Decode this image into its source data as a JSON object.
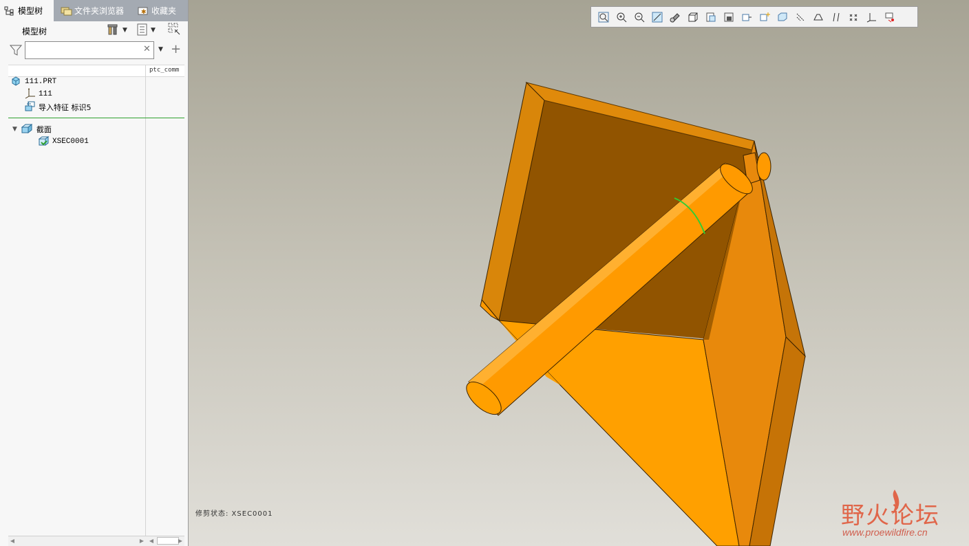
{
  "tabs": [
    {
      "label": "模型树",
      "icon": "model-tree-icon",
      "active": true
    },
    {
      "label": "文件夹浏览器",
      "icon": "folder-browser-icon",
      "active": false
    },
    {
      "label": "收藏夹",
      "icon": "favorites-icon",
      "active": false
    }
  ],
  "model_tree": {
    "title": "模型树",
    "search_value": "",
    "column_header": "ptc_comm",
    "items": [
      {
        "label": "111.PRT",
        "icon": "part-icon"
      },
      {
        "label": "111",
        "icon": "coordinate-system-icon"
      },
      {
        "label": "导入特征 标识5",
        "icon": "import-feature-icon"
      }
    ],
    "section_group": {
      "label": "截面",
      "icon": "section-icon",
      "expanded": true
    },
    "section_items": [
      {
        "label": "XSEC0001",
        "icon": "xsection-icon"
      }
    ]
  },
  "viewport": {
    "toolbar_icons": [
      "refit-icon",
      "zoom-in-icon",
      "zoom-out-icon",
      "repaint-icon",
      "display-style-icon",
      "saved-orientations-icon",
      "view-manager-icon",
      "perspective-icon",
      "spin-center-icon",
      "annotation-display-icon",
      "datum-display-icon",
      "plane-display-icon",
      "axis-display-icon",
      "point-display-icon",
      "csys-display-icon",
      "appearance-icon",
      "connection-icon"
    ],
    "status_text": "修剪状态: XSEC0001",
    "colors": {
      "model": "#ff9900",
      "model_dark": "#915400",
      "section_line": "#33cc33"
    }
  },
  "watermark": {
    "title": "野火论坛",
    "url": "www.proewildfire.cn"
  }
}
